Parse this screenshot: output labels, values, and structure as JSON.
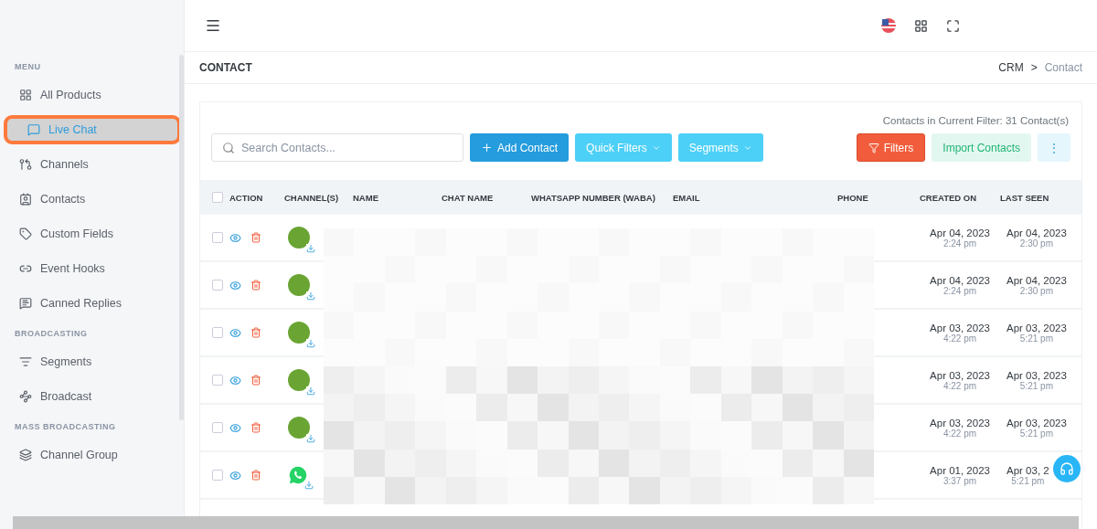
{
  "sidebar": {
    "sections": [
      {
        "title": "MENU",
        "items": [
          {
            "label": "All Products",
            "selected": false
          },
          {
            "label": "Live Chat",
            "selected": true
          },
          {
            "label": "Channels",
            "selected": false
          },
          {
            "label": "Contacts",
            "selected": false
          },
          {
            "label": "Custom Fields",
            "selected": false
          },
          {
            "label": "Event Hooks",
            "selected": false
          },
          {
            "label": "Canned Replies",
            "selected": false
          }
        ]
      },
      {
        "title": "BROADCASTING",
        "items": [
          {
            "label": "Segments",
            "selected": false
          },
          {
            "label": "Broadcast",
            "selected": false
          }
        ]
      },
      {
        "title": "MASS BROADCASTING",
        "items": [
          {
            "label": "Channel Group",
            "selected": false
          }
        ]
      }
    ]
  },
  "page": {
    "title": "CONTACT",
    "breadcrumb": [
      {
        "label": "CRM",
        "selected": false
      },
      {
        "label": "Contact",
        "selected": true
      }
    ],
    "breadcrumb_separator": ">"
  },
  "toolbar": {
    "count": "Contacts in Current Filter: 31 Contact(s)",
    "search": {
      "placeholder": "Search Contacts..."
    },
    "buttons": [
      {
        "label": "Add Contact",
        "kind": "primary"
      },
      {
        "label": "Quick Filters",
        "kind": "dropdown"
      },
      {
        "label": "Segments",
        "kind": "dropdown"
      }
    ],
    "right_buttons": [
      {
        "label": "Filters",
        "kind": "danger"
      },
      {
        "label": "Import Contacts",
        "kind": "soft"
      },
      {
        "label": "⋮",
        "kind": "more"
      }
    ]
  },
  "table": {
    "header_checked": false,
    "columns": [
      "ACTION",
      "CHANNEL(S)",
      "NAME",
      "CHAT NAME",
      "WHATSAPP NUMBER (WABA)",
      "EMAIL",
      "PHONE",
      "CREATED ON",
      "LAST SEEN"
    ],
    "rows": [
      {
        "checked": false,
        "kind": "avatar",
        "created_date": "Apr 04, 2023",
        "created_time": "2:24 pm",
        "seen_date": "Apr 04, 2023",
        "seen_time": "2:30 pm"
      },
      {
        "checked": false,
        "kind": "avatar",
        "created_date": "Apr 04, 2023",
        "created_time": "2:24 pm",
        "seen_date": "Apr 04, 2023",
        "seen_time": "2:30 pm"
      },
      {
        "checked": false,
        "kind": "avatar",
        "created_date": "Apr 03, 2023",
        "created_time": "4:22 pm",
        "seen_date": "Apr 03, 2023",
        "seen_time": "5:21 pm"
      },
      {
        "checked": false,
        "kind": "avatar",
        "created_date": "Apr 03, 2023",
        "created_time": "4:22 pm",
        "seen_date": "Apr 03, 2023",
        "seen_time": "5:21 pm"
      },
      {
        "checked": false,
        "kind": "avatar",
        "created_date": "Apr 03, 2023",
        "created_time": "4:22 pm",
        "seen_date": "Apr 03, 2023",
        "seen_time": "5:21 pm"
      },
      {
        "checked": false,
        "kind": "whatsapp",
        "created_date": "Apr 01, 2023",
        "created_time": "3:37 pm",
        "seen_date": "Apr 03, 2",
        "seen_time": "5:21 pm"
      }
    ]
  }
}
